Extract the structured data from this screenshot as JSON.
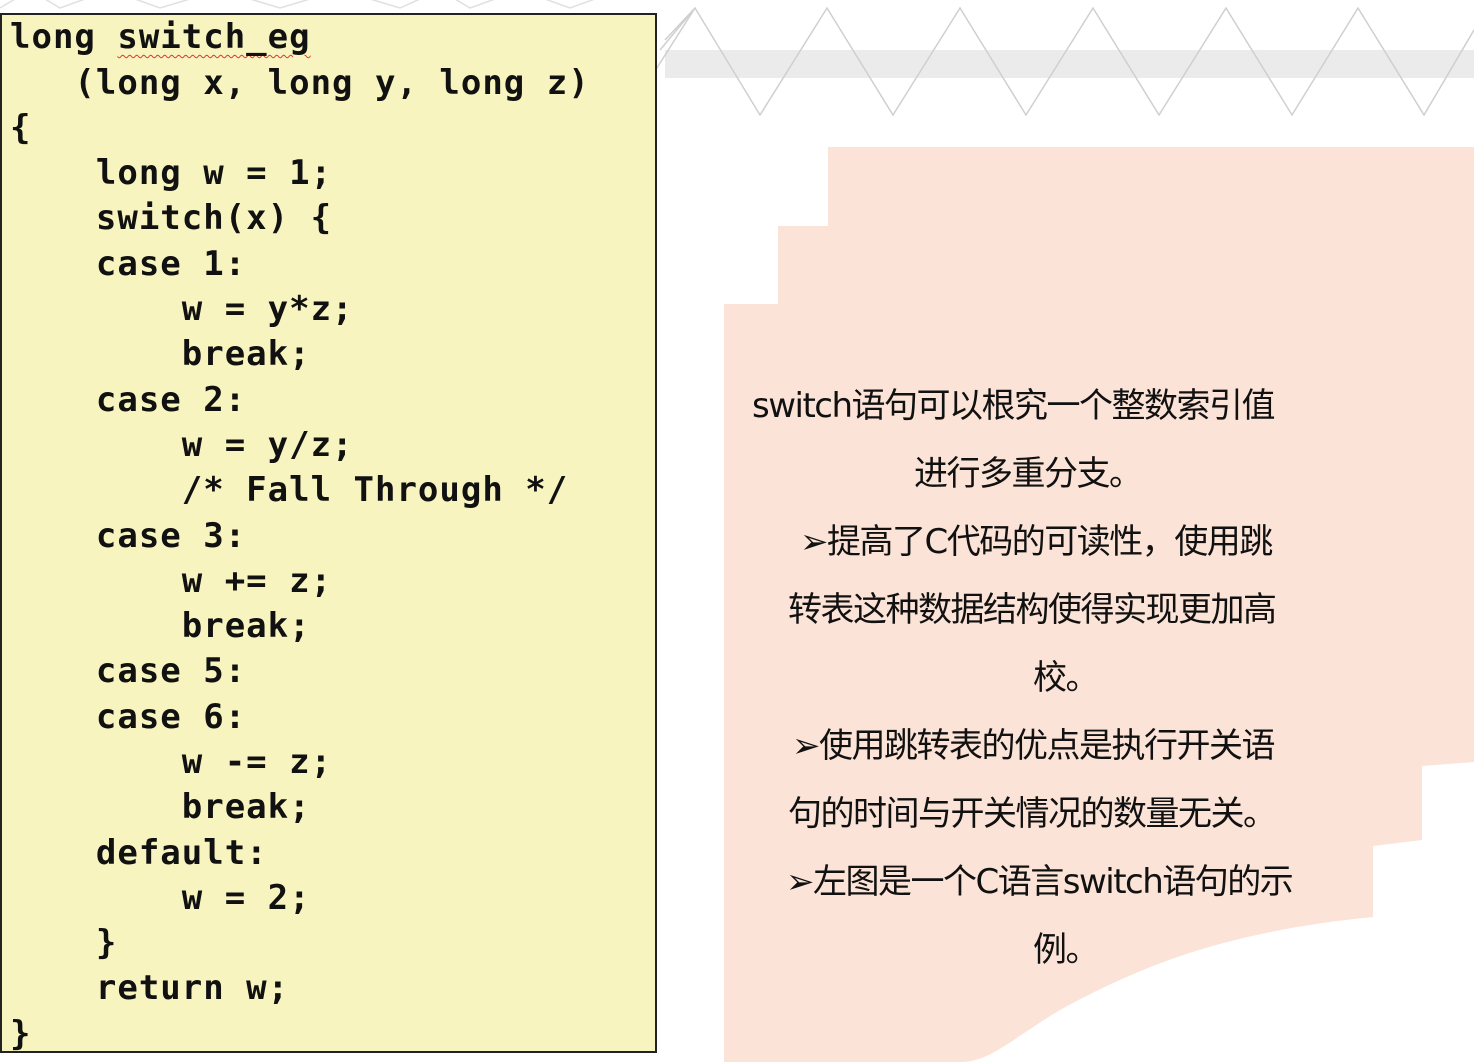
{
  "code": {
    "lines": [
      "long switch_eg",
      "   (long x, long y, long z)",
      "{",
      "    long w = 1;",
      "    switch(x) {",
      "    case 1:",
      "        w = y*z;",
      "        break;",
      "    case 2:",
      "        w = y/z;",
      "        /* Fall Through */",
      "    case 3:",
      "        w += z;",
      "        break;",
      "    case 5:",
      "    case 6:",
      "        w -= z;",
      "        break;",
      "    default:",
      "        w = 2;",
      "    }",
      "    return w;",
      "}"
    ]
  },
  "note": {
    "lines": [
      "switch语句可以根究一个整数索引值",
      "进行多重分支。",
      "➢提高了C代码的可读性，使用跳",
      "转表这种数据结构使得实现更加高",
      "校。",
      "➢使用跳转表的优点是执行开关语",
      "句的时间与开关情况的数量无关。",
      "➢左图是一个C语言switch语句的示",
      "例。"
    ]
  },
  "colors": {
    "code_background": "#f7f4bf",
    "note_background": "#fbe3d7"
  }
}
